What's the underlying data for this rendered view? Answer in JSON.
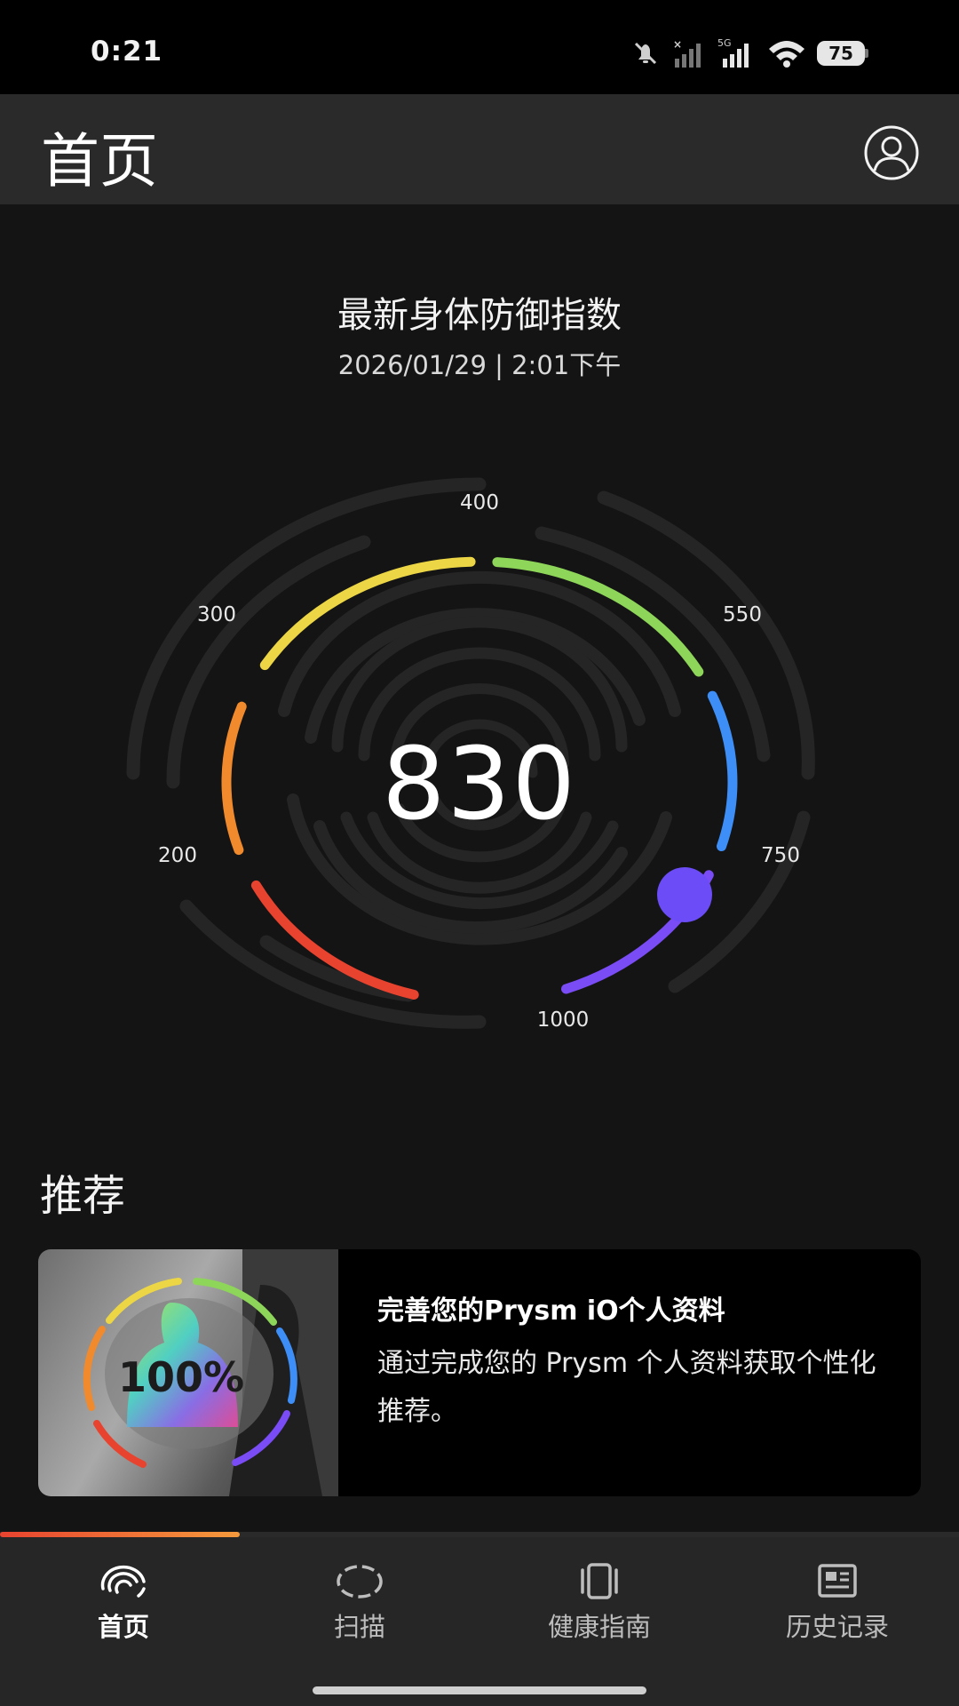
{
  "status_bar": {
    "time": "0:21",
    "network": "5G",
    "battery": "75",
    "icons": [
      "mute-bell-icon",
      "signal-no-sim-icon",
      "signal-5g-icon",
      "wifi-icon",
      "battery-icon"
    ]
  },
  "header": {
    "title": "首页",
    "profile_icon": "user-profile-icon"
  },
  "score": {
    "title": "最新身体防御指数",
    "date": "2026/01/29 | 2:01下午",
    "value": "830",
    "ticks": [
      "200",
      "300",
      "400",
      "550",
      "750",
      "1000"
    ],
    "colors": {
      "red": "#e8432f",
      "orange": "#f08a2c",
      "yellow": "#ecd646",
      "green": "#8ed65a",
      "blue": "#3e8ef7",
      "purple": "#7a4cf5",
      "knob": "#6b4cf6"
    }
  },
  "recommendations": {
    "section_title": "推荐",
    "card": {
      "thumb_label": "100%",
      "title": "完善您的Prysm iO个人资料",
      "description": "通过完成您的 Prysm 个人资料获取个性化推荐。"
    }
  },
  "progress": {
    "fraction": 0.25
  },
  "bottom_nav": {
    "items": [
      {
        "label": "首页",
        "icon": "fingerprint-icon",
        "active": true
      },
      {
        "label": "扫描",
        "icon": "scan-ring-icon",
        "active": false
      },
      {
        "label": "健康指南",
        "icon": "device-guide-icon",
        "active": false
      },
      {
        "label": "历史记录",
        "icon": "history-news-icon",
        "active": false
      }
    ]
  }
}
